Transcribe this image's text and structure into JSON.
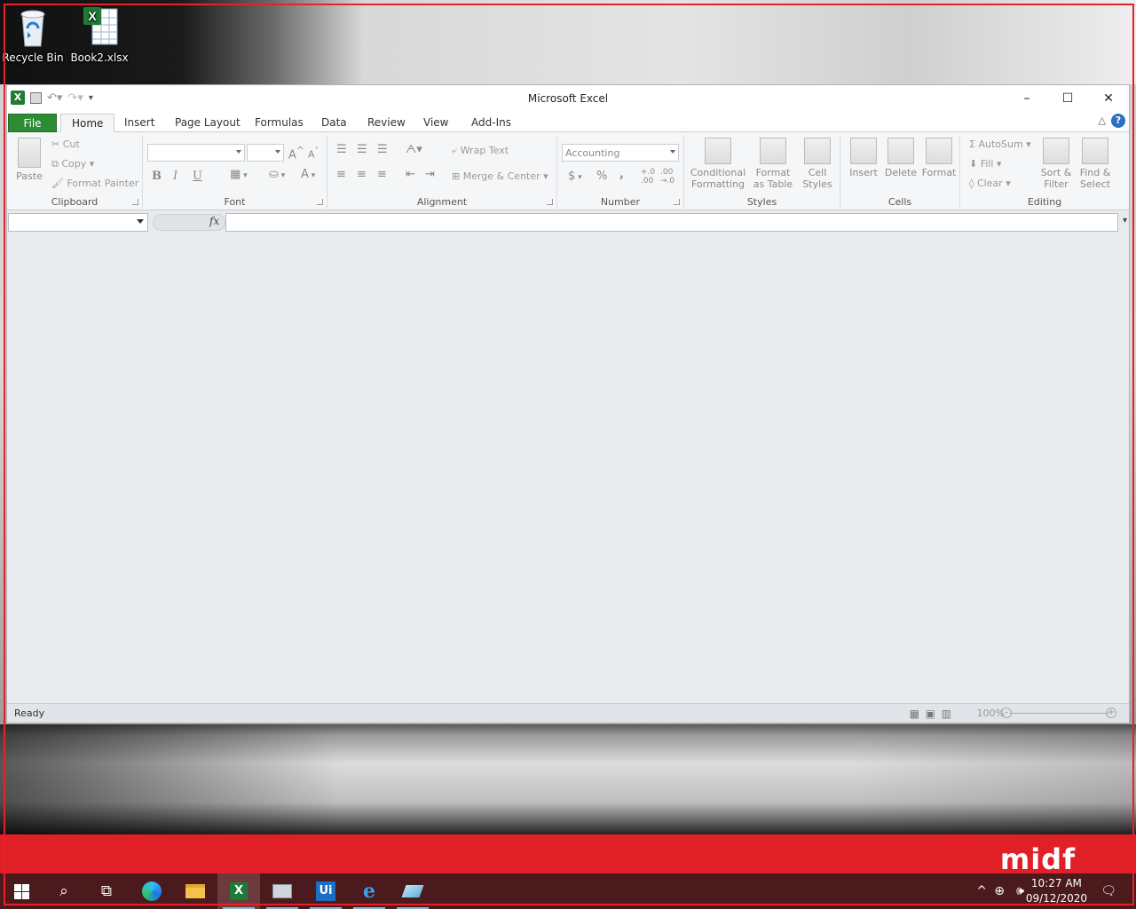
{
  "desktop": {
    "icons": [
      {
        "label": "Recycle Bin",
        "icon": "recycle-bin-icon"
      },
      {
        "label": "Book2.xlsx",
        "icon": "excel-file-icon"
      }
    ]
  },
  "window": {
    "title": "Microsoft Excel",
    "controls": {
      "minimize": "–",
      "maximize": "☐",
      "close": "✕"
    },
    "tabs": [
      "File",
      "Home",
      "Insert",
      "Page Layout",
      "Formulas",
      "Data",
      "Review",
      "View",
      "Add-Ins"
    ],
    "active_tab": "Home"
  },
  "ribbon": {
    "clipboard": {
      "label": "Clipboard",
      "paste": "Paste",
      "cut": "Cut",
      "copy": "Copy",
      "format_painter": "Format Painter"
    },
    "font": {
      "label": "Font",
      "bold": "B",
      "italic": "I",
      "underline": "U",
      "grow": "A",
      "shrink": "A",
      "color": "A"
    },
    "alignment": {
      "label": "Alignment",
      "wrap_text": "Wrap Text",
      "merge_center": "Merge & Center"
    },
    "number": {
      "label": "Number",
      "format": "Accounting",
      "currency": "$",
      "percent": "%",
      "comma": ",",
      "inc_decimal": "+.0 .00",
      "dec_decimal": ".00 →.0"
    },
    "styles": {
      "label": "Styles",
      "conditional": "Conditional Formatting",
      "format_table": "Format as Table",
      "cell_styles": "Cell Styles"
    },
    "cells": {
      "label": "Cells",
      "insert": "Insert",
      "delete": "Delete",
      "format": "Format"
    },
    "editing": {
      "label": "Editing",
      "autosum": "AutoSum",
      "fill": "Fill",
      "clear": "Clear",
      "sort_filter": "Sort & Filter",
      "find_select": "Find & Select"
    }
  },
  "formula_bar": {
    "fx": "fx",
    "name_box": "",
    "formula": ""
  },
  "statusbar": {
    "ready": "Ready",
    "zoom": "100%"
  },
  "logo": {
    "text": "midf"
  },
  "taskbar": {
    "clock": {
      "time": "10:27 AM",
      "date": "09/12/2020"
    }
  },
  "colors": {
    "excel_green": "#2d8a35",
    "brand_red": "#e11f26",
    "taskbar": "#4a1a1c"
  }
}
